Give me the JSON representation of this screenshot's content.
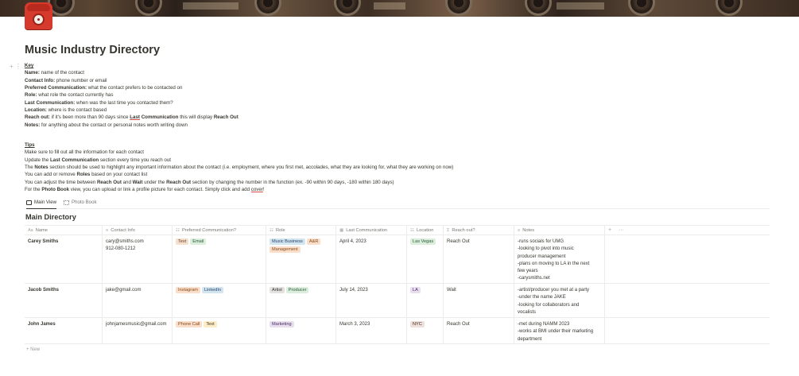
{
  "page": {
    "title": "Music Industry Directory",
    "icon": "red-telephone-icon"
  },
  "key": {
    "heading": "Key",
    "lines": [
      {
        "label": "Name:",
        "text": " name of the contact"
      },
      {
        "label": "Contact Info:",
        "text": " phone number or email"
      },
      {
        "label": "Preferred Communication:",
        "text": " what the contact prefers to be contacted on"
      },
      {
        "label": "Role:",
        "text": " what role the contact currently has"
      },
      {
        "label": "Last Communication:",
        "text": " when was the last time you contacted them?"
      },
      {
        "label": "Location:",
        "text": " where is the contact based"
      },
      {
        "label": "Notes:",
        "text": " for anything about the contact or personal notes worth writing down"
      }
    ],
    "reach_out": {
      "label": "Reach out:",
      "text_a": " if it's been more than 90 days since ",
      "link": "Last",
      "text_b": " ",
      "bold_b": "Communication",
      "text_c": " this will display ",
      "bold_c": "Reach Out"
    }
  },
  "tips": {
    "heading": "Tips",
    "line1": "Make sure to fill out all the information for each contact",
    "line2": {
      "a": "Update the ",
      "b": "Last Communication",
      "c": " section every time you reach out"
    },
    "line3": {
      "a": "The ",
      "b": "Notes",
      "c": " section should be used to highlight any important information about the contact (i.e. employment, where you first met, accolades, what they are looking for, what they are working on now)"
    },
    "line4": {
      "a": "You can add or remove ",
      "b": "Roles",
      "c": " based on your contact list"
    },
    "line5": {
      "a": "You can adjust the time between ",
      "b": "Reach Out",
      "c": " and ",
      "d": "Wait",
      "e": " under the ",
      "f": "Reach Out",
      "g": " section by changing the number in the function (ex. -90 within 90 days, -180 within 180 days)"
    },
    "line6": {
      "a": "For the ",
      "b": "Photo Book",
      "c": " view, you can upload or link a profile picture for each contact. Simply click and add ",
      "d": "cover",
      "e": "!"
    }
  },
  "views": {
    "tabs": [
      {
        "label": "Main View",
        "icon": "table-icon"
      },
      {
        "label": "Photo Book",
        "icon": "gallery-icon"
      }
    ]
  },
  "database": {
    "title": "Main Directory",
    "columns": [
      {
        "label": "Name",
        "icon": "Aa"
      },
      {
        "label": "Contact Info",
        "icon": "≡"
      },
      {
        "label": "Preferred Communication?",
        "icon": "☷"
      },
      {
        "label": "Role",
        "icon": "☷"
      },
      {
        "label": "Last Communication",
        "icon": "▦"
      },
      {
        "label": "Location",
        "icon": "☷"
      },
      {
        "label": "Reach out?",
        "icon": "Σ"
      },
      {
        "label": "Notes",
        "icon": "≡"
      }
    ],
    "add_column": "+",
    "more": "···",
    "rows": [
      {
        "name": "Carey Smiths",
        "contact": [
          "cary@smiths.com",
          "912-080-1212"
        ],
        "comm": [
          {
            "text": "Text",
            "bg": "#f5e0cf",
            "fg": "#6b3b1f"
          },
          {
            "text": "Email",
            "bg": "#dbeddb",
            "fg": "#2b593f"
          }
        ],
        "role": [
          {
            "text": "Music Business",
            "bg": "#d3e5ef",
            "fg": "#28456c"
          },
          {
            "text": "A&R",
            "bg": "#fadec9",
            "fg": "#854c1d"
          },
          {
            "text": "Management",
            "bg": "#fadec9",
            "fg": "#854c1d"
          }
        ],
        "last": "April 4, 2023",
        "location": {
          "text": "Las Vegas",
          "bg": "#dbeddb",
          "fg": "#2b593f"
        },
        "reach": "Reach Out",
        "notes": [
          "-runs socials for UMG",
          "-looking to pivot into music",
          "producer management",
          "-plans on moving to LA in the next",
          "few years",
          "-carysmiths.net"
        ]
      },
      {
        "name": "Jacob Smiths",
        "contact": [
          "jake@gmail.com"
        ],
        "comm": [
          {
            "text": "Instagram",
            "bg": "#fadec9",
            "fg": "#854c1d"
          },
          {
            "text": "LinkedIn",
            "bg": "#d3e5ef",
            "fg": "#28456c"
          }
        ],
        "role": [
          {
            "text": "Artist",
            "bg": "#e3e2e0",
            "fg": "#32302c"
          },
          {
            "text": "Producer",
            "bg": "#dbeddb",
            "fg": "#2b593f"
          }
        ],
        "last": "July 14, 2023",
        "location": {
          "text": "LA",
          "bg": "#e8deee",
          "fg": "#492f64"
        },
        "reach": "Wait",
        "notes": [
          "-artist/producer you met at a party",
          "-under the name JAKE",
          "-looking for collaborators and",
          "vocalists"
        ]
      },
      {
        "name": "John James",
        "contact": [
          "johnjamesmusic@gmail.com"
        ],
        "comm": [
          {
            "text": "Phone Call",
            "bg": "#fadec9",
            "fg": "#854c1d"
          },
          {
            "text": "Text",
            "bg": "#fdecc8",
            "fg": "#402c1b"
          }
        ],
        "role": [
          {
            "text": "Marketing",
            "bg": "#e8deee",
            "fg": "#492f64"
          }
        ],
        "last": "March 3, 2023",
        "location": {
          "text": "NYC",
          "bg": "#eee0da",
          "fg": "#442a1e"
        },
        "reach": "Reach Out",
        "notes": [
          "-met during NAMM 2023",
          "-works at BMI under their marketing",
          "department"
        ]
      }
    ],
    "new_label": "New"
  }
}
